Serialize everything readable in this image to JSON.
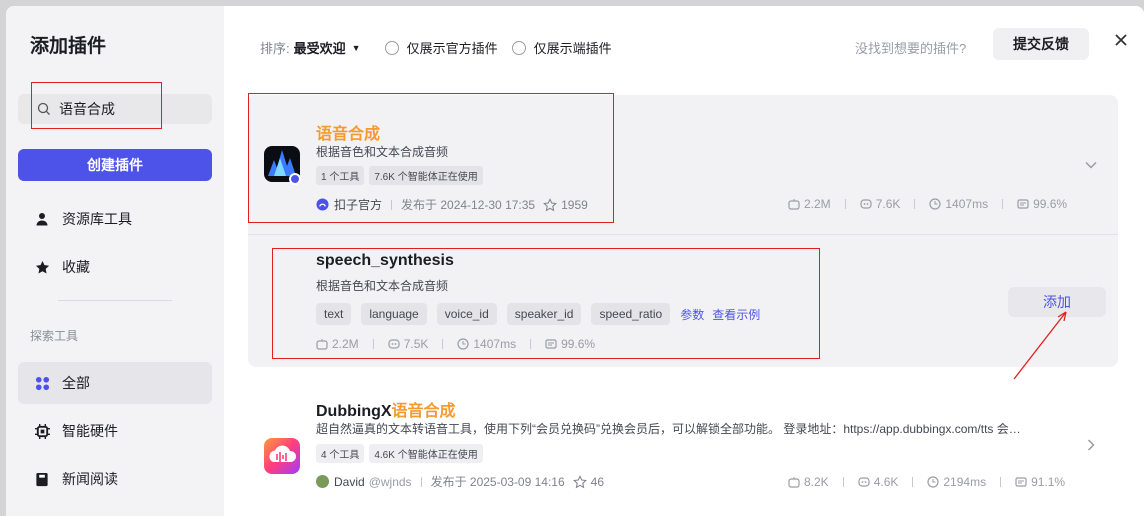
{
  "sidebar": {
    "title": "添加插件",
    "search_value": "语音合成",
    "create_button": "创建插件",
    "items": [
      {
        "label": "资源库工具",
        "icon": "user-icon"
      },
      {
        "label": "收藏",
        "icon": "star-icon"
      }
    ],
    "section_label": "探索工具",
    "explore_items": [
      {
        "label": "全部",
        "icon": "grid-icon",
        "active": true
      },
      {
        "label": "智能硬件",
        "icon": "chip-icon"
      },
      {
        "label": "新闻阅读",
        "icon": "book-icon"
      }
    ]
  },
  "toolbar": {
    "sort_label": "排序:",
    "sort_value": "最受欢迎",
    "filter_official": "仅展示官方插件",
    "filter_device": "仅展示端插件",
    "not_found": "没找到想要的插件?",
    "feedback_button": "提交反馈"
  },
  "plugins": [
    {
      "name_highlight": "语音合成",
      "name_rest": "",
      "description": "根据音色和文本合成音频",
      "tags": [
        "1 个工具",
        "7.6K 个智能体正在使用"
      ],
      "author": "扣子官方",
      "published": "发布于 2024-12-30 17:35",
      "stars": "1959",
      "stats": [
        "2.2M",
        "7.6K",
        "1407ms",
        "99.6%"
      ],
      "tool": {
        "name": "speech_synthesis",
        "description": "根据音色和文本合成音频",
        "params": [
          "text",
          "language",
          "voice_id",
          "speaker_id",
          "speed_ratio"
        ],
        "param_link": "参数",
        "example_link": "查看示例",
        "stats": [
          "2.2M",
          "7.5K",
          "1407ms",
          "99.6%"
        ],
        "add_button": "添加"
      }
    },
    {
      "name_prefix": "DubbingX",
      "name_highlight": "语音合成",
      "description": "超自然逼真的文本转语音工具，使用下列“会员兑换码”兑换会员后，可以解锁全部功能。 登录地址：https://app.dubbingx.com/tts 会…",
      "tags": [
        "4 个工具",
        "4.6K 个智能体正在使用"
      ],
      "author": "David",
      "handle": "@wjnds",
      "published": "发布于 2025-03-09 14:16",
      "stars": "46",
      "stats": [
        "8.2K",
        "4.6K",
        "2194ms",
        "91.1%"
      ]
    }
  ],
  "colors": {
    "accent": "#4d53e8",
    "highlight": "#f39b2f",
    "annotation": "#e02020"
  }
}
